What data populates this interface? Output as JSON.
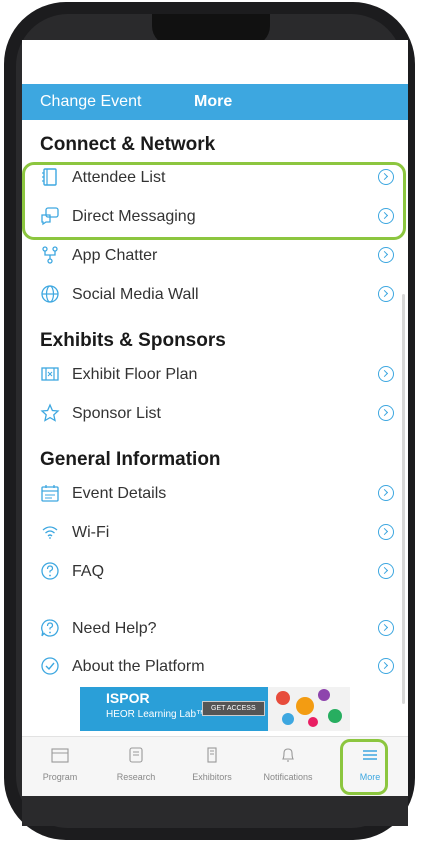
{
  "header": {
    "change_event": "Change Event",
    "more": "More"
  },
  "sections": {
    "connect": {
      "title": "Connect & Network",
      "items": [
        {
          "label": "Attendee List",
          "icon": "address-book-icon"
        },
        {
          "label": "Direct Messaging",
          "icon": "chat-icon"
        },
        {
          "label": "App Chatter",
          "icon": "network-icon"
        },
        {
          "label": "Social Media Wall",
          "icon": "globe-icon"
        }
      ]
    },
    "exhibits": {
      "title": "Exhibits & Sponsors",
      "items": [
        {
          "label": "Exhibit Floor Plan",
          "icon": "floor-plan-icon"
        },
        {
          "label": "Sponsor List",
          "icon": "star-icon"
        }
      ]
    },
    "general": {
      "title": "General Information",
      "items": [
        {
          "label": "Event Details",
          "icon": "calendar-icon"
        },
        {
          "label": "Wi-Fi",
          "icon": "wifi-icon"
        },
        {
          "label": "FAQ",
          "icon": "question-icon"
        },
        {
          "label": "Need Help?",
          "icon": "help-icon"
        },
        {
          "label": "About the Platform",
          "icon": "check-circle-icon"
        }
      ]
    }
  },
  "banner": {
    "brand": "ISPOR",
    "subtitle": "HEOR Learning Lab™",
    "cta": "GET ACCESS"
  },
  "tabs": [
    {
      "label": "Program",
      "icon": "program-icon"
    },
    {
      "label": "Research",
      "icon": "research-icon"
    },
    {
      "label": "Exhibitors",
      "icon": "exhibitors-icon"
    },
    {
      "label": "Notifications",
      "icon": "bell-icon"
    },
    {
      "label": "More",
      "icon": "menu-icon"
    }
  ],
  "colors": {
    "accent": "#3da7e0",
    "highlight": "#8cc63f"
  }
}
